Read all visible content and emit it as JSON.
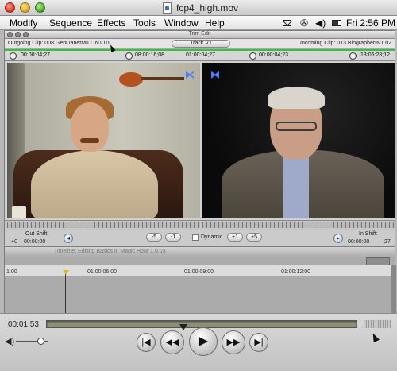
{
  "window": {
    "title": "fcp4_high.mov"
  },
  "menubar": {
    "items": [
      "Modify",
      "Sequence",
      "Effects",
      "Tools",
      "Window",
      "Help"
    ],
    "clock": "Fri 2:56 PM"
  },
  "trim_edit": {
    "title": "Trim Edit",
    "outgoing_clip": "Outgoing Clip: 008 GentJanetMILLINT 01",
    "incoming_clip": "Incoming Clip: 013 BiographerINT 02",
    "track": "Track V1",
    "timecodes": {
      "out_duration": "00:00:04;27",
      "out_position": "08:00:16;08",
      "center": "01:00:04;27",
      "in_duration": "00:00:04;23",
      "in_position": "13:06:28;12"
    },
    "out_shift_label": "Out Shift:",
    "in_shift_label": "In Shift:",
    "out_shift_value": "+0",
    "out_shift_time": "00:00:00",
    "in_shift_value": "00:00:00",
    "in_shift_frames": "27",
    "buttons": {
      "minus5": "-5",
      "minus1": "-1",
      "plus1": "+1",
      "plus5": "+5",
      "dynamic": "Dynamic"
    }
  },
  "timeline": {
    "title": "Timeline: Editing Basics in Magic Hour 1.0.03",
    "ticks": [
      "1:00",
      "01:00:06:00",
      "01:00:09:00",
      "01:00:12:00"
    ]
  },
  "player": {
    "current_time": "00:01:53",
    "progress_fraction": 0.44,
    "volume_fraction": 0.78
  },
  "icons": {
    "mark_in": "mark-in-icon",
    "play": "play-icon",
    "rewind": "rewind-icon",
    "fast_forward": "fast-forward-icon"
  }
}
